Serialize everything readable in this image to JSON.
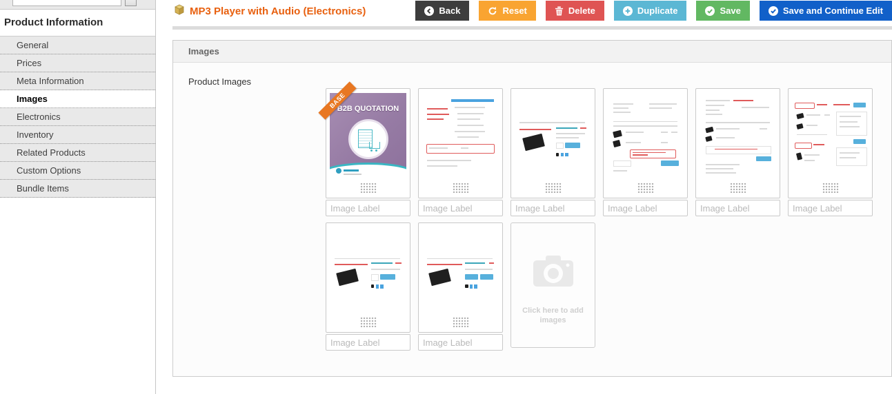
{
  "sidebar": {
    "heading": "Product Information",
    "search_value": "",
    "items": [
      {
        "label": "General",
        "active": false
      },
      {
        "label": "Prices",
        "active": false
      },
      {
        "label": "Meta Information",
        "active": false
      },
      {
        "label": "Images",
        "active": true
      },
      {
        "label": "Electronics",
        "active": false
      },
      {
        "label": "Inventory",
        "active": false
      },
      {
        "label": "Related Products",
        "active": false
      },
      {
        "label": "Custom Options",
        "active": false
      },
      {
        "label": "Bundle Items",
        "active": false
      }
    ]
  },
  "header": {
    "title": "MP3 Player with Audio (Electronics)",
    "buttons": {
      "back": "Back",
      "reset": "Reset",
      "delete": "Delete",
      "duplicate": "Duplicate",
      "save": "Save",
      "save_continue": "Save and Continue Edit"
    }
  },
  "panel": {
    "title": "Images",
    "field_label": "Product Images"
  },
  "gallery": {
    "base_badge": "BASE",
    "label_placeholder": "Image Label",
    "add_tile_text": "Click here to add images",
    "images": [
      {
        "name": "b2b-quotation-cover",
        "text": "B2B QUOTATION",
        "badge": "BASE"
      },
      {
        "name": "configuration-settings-screenshot"
      },
      {
        "name": "product-page-screenshot"
      },
      {
        "name": "shopping-cart-screenshot"
      },
      {
        "name": "quote-request-form-screenshot"
      },
      {
        "name": "quote-management-screenshot"
      },
      {
        "name": "product-page-screenshot-2"
      },
      {
        "name": "product-page-screenshot-3"
      }
    ]
  },
  "colors": {
    "accent_orange": "#e8600f",
    "badge_orange": "#e87722",
    "btn_back": "#3d3d3d",
    "btn_reset": "#f9a431",
    "btn_delete": "#df5453",
    "btn_duplicate": "#5bb7d4",
    "btn_save": "#62b862",
    "btn_save_continue": "#1160c9"
  }
}
